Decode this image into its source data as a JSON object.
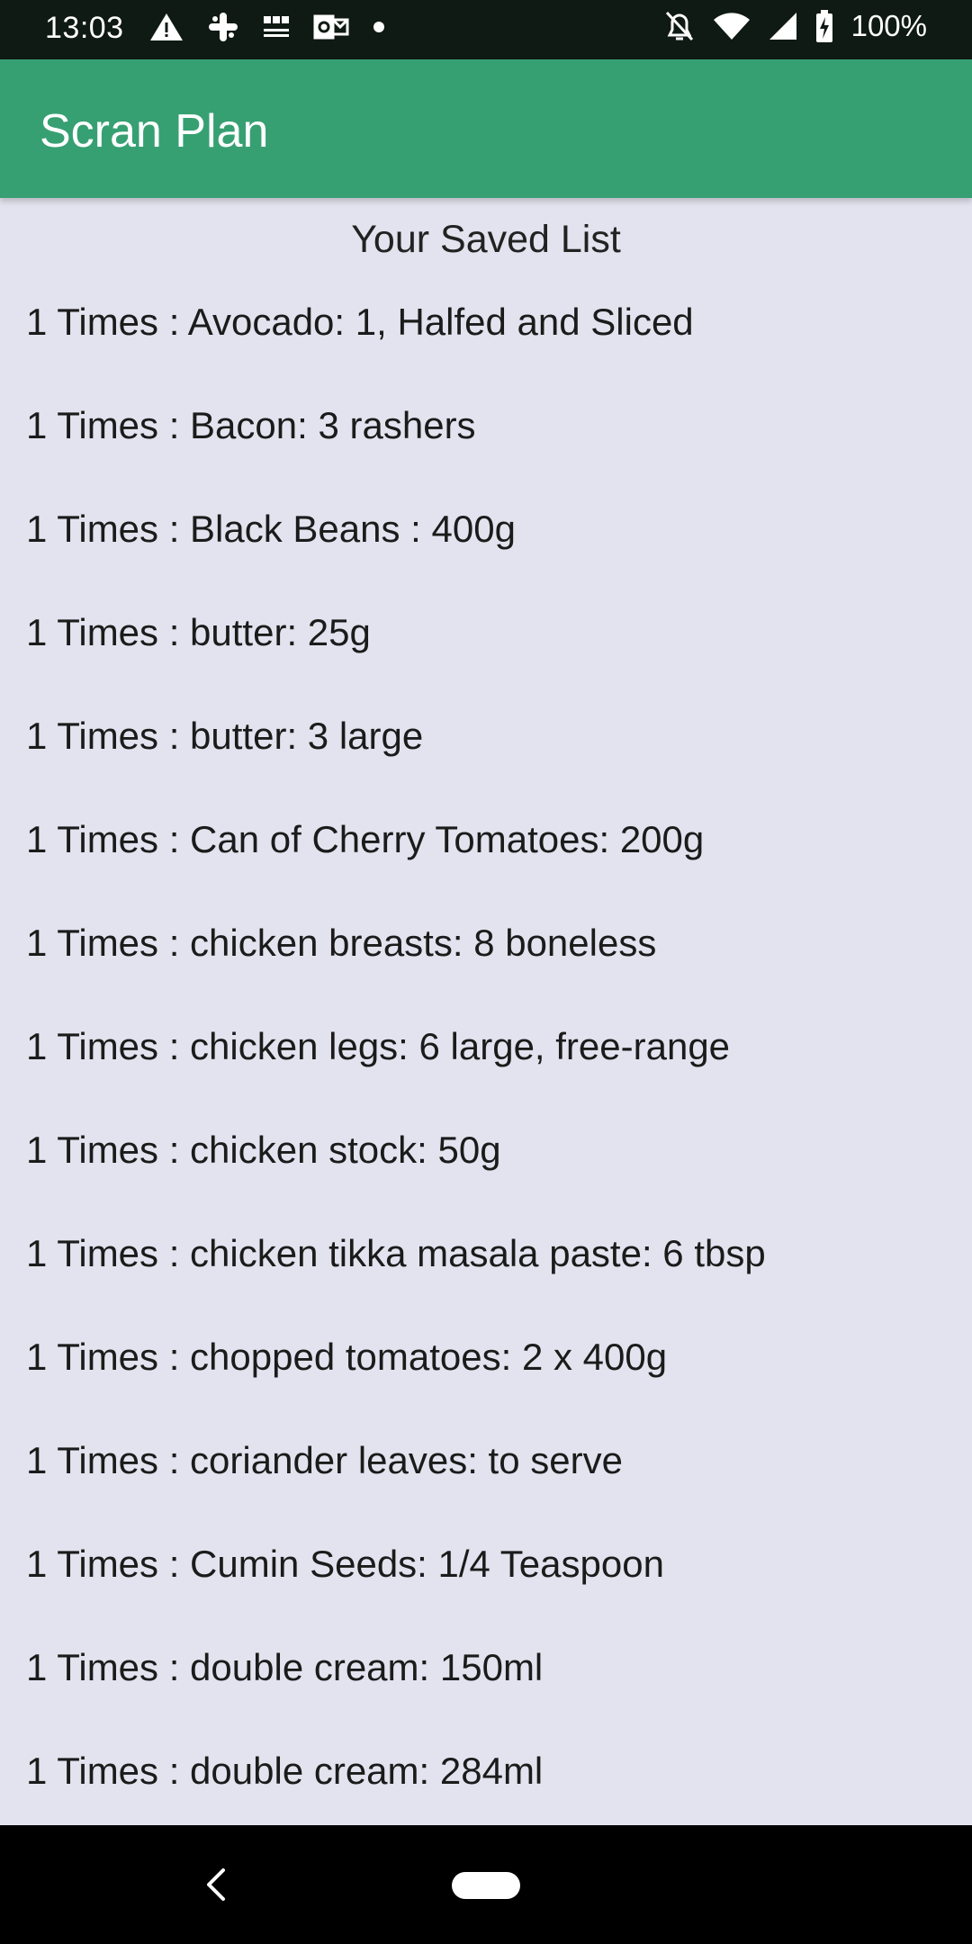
{
  "status_bar": {
    "time": "13:03",
    "battery": "100%",
    "left_icons": [
      "warning-icon",
      "slack-icon",
      "bbc-news-icon",
      "outlook-icon",
      "dot-icon"
    ],
    "right_icons": [
      "alarm-off-icon",
      "wifi-icon",
      "signal-icon",
      "battery-charging-icon"
    ]
  },
  "app_bar": {
    "title": "Scran Plan",
    "color": "#37a073"
  },
  "main": {
    "heading": "Your Saved List",
    "items": [
      "1 Times : Avocado: 1, Halfed and Sliced",
      "1 Times : Bacon: 3 rashers",
      "1 Times : Black Beans : 400g",
      "1 Times : butter: 25g",
      "1 Times : butter: 3 large",
      "1 Times : Can of Cherry Tomatoes: 200g",
      "1 Times : chicken breasts: 8 boneless",
      "1 Times : chicken legs: 6 large, free-range",
      "1 Times : chicken stock: 50g",
      "1 Times : chicken tikka masala paste: 6 tbsp",
      "1 Times : chopped tomatoes: 2 x 400g",
      "1 Times : coriander leaves: to serve",
      "1 Times : Cumin Seeds: 1/4 Teaspoon",
      "1 Times : double cream: 150ml",
      "1 Times : double cream: 284ml"
    ]
  },
  "nav_bar": {
    "icons": [
      "back-icon",
      "home-pill-icon"
    ]
  }
}
